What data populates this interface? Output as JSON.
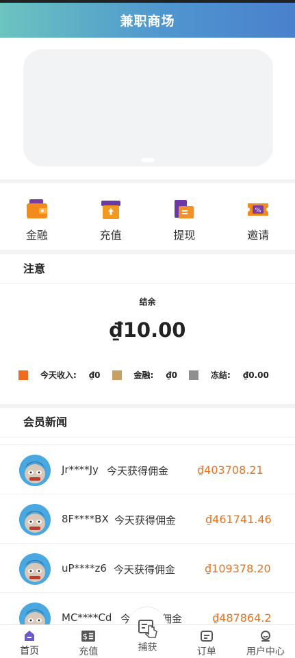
{
  "header": {
    "title": "兼职商场"
  },
  "quick_menu": [
    {
      "label": "金融",
      "icon": "wallet-icon"
    },
    {
      "label": "充值",
      "icon": "recharge-box-icon"
    },
    {
      "label": "提现",
      "icon": "withdraw-wallet-icon"
    },
    {
      "label": "邀请",
      "icon": "coupon-icon"
    }
  ],
  "notice": {
    "title": "注意",
    "balance_label": "结余",
    "balance_value": "₫10.00",
    "stats": [
      {
        "label": "今天收入:",
        "value": "₫0",
        "color": "#f26a1b"
      },
      {
        "label": "金融:",
        "value": "₫0",
        "color": "#c9a063"
      },
      {
        "label": "冻结:",
        "value": "₫0.00",
        "color": "#8f8f8f"
      }
    ]
  },
  "news": {
    "title": "会员新闻",
    "items": [
      {
        "user": "Jr****Jy",
        "text": "今天获得佣金",
        "amount": "₫403708.21"
      },
      {
        "user": "8F****BX",
        "text": "今天获得佣金",
        "amount": "₫461741.46"
      },
      {
        "user": "uP****z6",
        "text": "今天获得佣金",
        "amount": "₫109378.20"
      },
      {
        "user": "MC****Cd",
        "text": "今天获得佣金",
        "amount": "₫487864.2"
      }
    ]
  },
  "tabbar": [
    {
      "label": "首页",
      "icon": "home-icon",
      "active": true
    },
    {
      "label": "充值",
      "icon": "dollar-icon"
    },
    {
      "label": "捕获",
      "icon": "tap-hand-icon"
    },
    {
      "label": "订单",
      "icon": "order-icon"
    },
    {
      "label": "用户中心",
      "icon": "user-icon"
    }
  ],
  "colors": {
    "accent_orange": "#e8731f",
    "header_gradient_start": "#6cc4bf",
    "header_gradient_end": "#4a80cc",
    "tab_active": "#6a5acd"
  }
}
